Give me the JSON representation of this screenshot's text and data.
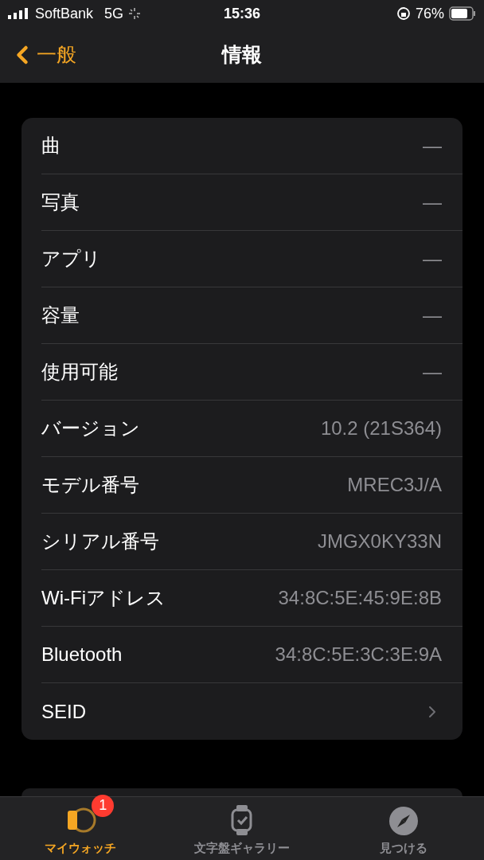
{
  "status_bar": {
    "carrier": "SoftBank",
    "network": "5G",
    "time": "15:36",
    "battery": "76%"
  },
  "nav": {
    "back": "一般",
    "title": "情報"
  },
  "rows": [
    {
      "label": "曲",
      "value": "—",
      "kind": "value"
    },
    {
      "label": "写真",
      "value": "—",
      "kind": "value"
    },
    {
      "label": "アプリ",
      "value": "—",
      "kind": "value"
    },
    {
      "label": "容量",
      "value": "—",
      "kind": "value"
    },
    {
      "label": "使用可能",
      "value": "—",
      "kind": "value"
    },
    {
      "label": "バージョン",
      "value": "10.2 (21S364)",
      "kind": "value"
    },
    {
      "label": "モデル番号",
      "value": "MREC3J/A",
      "kind": "value"
    },
    {
      "label": "シリアル番号",
      "value": "JMGX0KY33N",
      "kind": "value"
    },
    {
      "label": "Wi-Fiアドレス",
      "value": "34:8C:5E:45:9E:8B",
      "kind": "value"
    },
    {
      "label": "Bluetooth",
      "value": "34:8C:5E:3C:3E:9A",
      "kind": "value"
    },
    {
      "label": "SEID",
      "kind": "link"
    }
  ],
  "tabs": [
    {
      "label": "マイウォッチ",
      "selected": true,
      "badge": "1",
      "kind": "watch"
    },
    {
      "label": "文字盤ギャラリー",
      "selected": false,
      "kind": "face"
    },
    {
      "label": "見つける",
      "selected": false,
      "kind": "discover"
    }
  ]
}
